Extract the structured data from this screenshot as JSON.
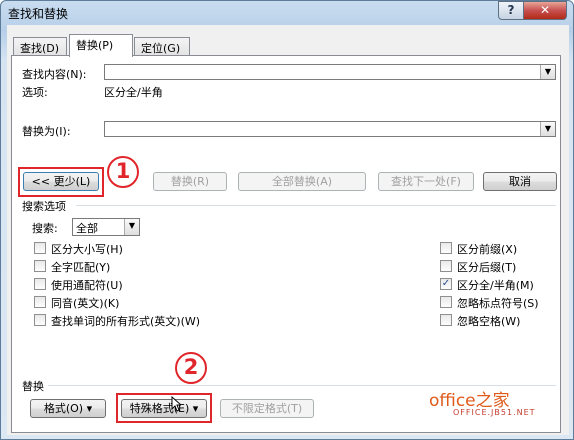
{
  "window": {
    "title": "查找和替换",
    "help_label": "?",
    "close_label": "✕"
  },
  "tabs": [
    {
      "label": "查找(D)"
    },
    {
      "label": "替换(P)"
    },
    {
      "label": "定位(G)"
    }
  ],
  "find": {
    "label": "查找内容(N):",
    "value": "",
    "options_label": "选项:",
    "options_value": "区分全/半角"
  },
  "replace": {
    "label": "替换为(I):",
    "value": ""
  },
  "buttons": {
    "less": "<< 更少(L)",
    "replace": "替换(R)",
    "replace_all": "全部替换(A)",
    "find_next": "查找下一处(F)",
    "cancel": "取消"
  },
  "search_options": {
    "section_label": "搜索选项",
    "search_label": "搜索:",
    "search_value": "全部",
    "left": [
      {
        "label": "区分大小写(H)",
        "checked": false
      },
      {
        "label": "全字匹配(Y)",
        "checked": false
      },
      {
        "label": "使用通配符(U)",
        "checked": false
      },
      {
        "label": "同音(英文)(K)",
        "checked": false
      },
      {
        "label": "查找单词的所有形式(英文)(W)",
        "checked": false
      }
    ],
    "right": [
      {
        "label": "区分前缀(X)",
        "checked": false
      },
      {
        "label": "区分后缀(T)",
        "checked": false
      },
      {
        "label": "区分全/半角(M)",
        "checked": true
      },
      {
        "label": "忽略标点符号(S)",
        "checked": false
      },
      {
        "label": "忽略空格(W)",
        "checked": false
      }
    ]
  },
  "replace_section": {
    "label": "替换",
    "format_btn": "格式(O) ▾",
    "special_btn": "特殊格式(E) ▾",
    "no_format_btn": "不限定格式(T)"
  },
  "annotations": {
    "one": "1",
    "two": "2"
  },
  "watermark": {
    "main": "office之家",
    "sub": "OFFICE.JB51.NET"
  }
}
